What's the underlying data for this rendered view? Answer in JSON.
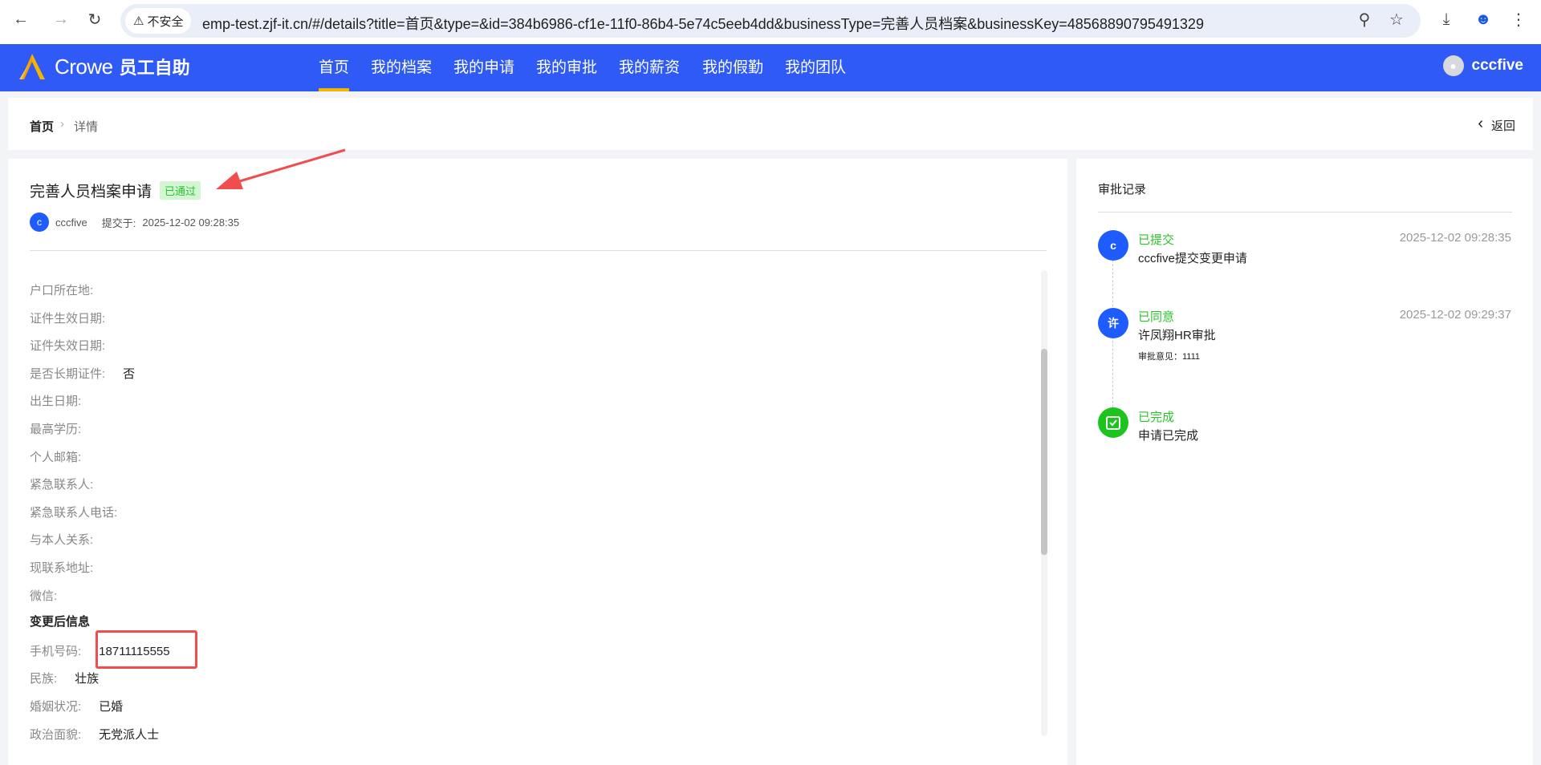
{
  "browser": {
    "insecure_label": "不安全",
    "url": "emp-test.zjf-it.cn/#/details?title=首页&type=&id=384b6986-cf1e-11f0-86b4-5e74c5eeb4dd&businessType=完善人员档案&businessKey=48568890795491329"
  },
  "header": {
    "brand": "Crowe",
    "app_name": "员工自助",
    "nav": [
      "首页",
      "我的档案",
      "我的申请",
      "我的审批",
      "我的薪资",
      "我的假勤",
      "我的团队"
    ],
    "active_index": 0,
    "user": "cccfive",
    "accent": "#2f5af5"
  },
  "breadcrumb": {
    "home": "首页",
    "current": "详情",
    "back": "返回"
  },
  "detail": {
    "title": "完善人员档案申请",
    "status": "已通过",
    "submitter_initial": "c",
    "submitter": "cccfive",
    "submitted_label": "提交于:",
    "submitted_at": "2025-12-02 09:28:35",
    "fields": [
      {
        "label": "户口所在地:",
        "value": ""
      },
      {
        "label": "证件生效日期:",
        "value": ""
      },
      {
        "label": "证件失效日期:",
        "value": ""
      },
      {
        "label": "是否长期证件:",
        "value": "否"
      },
      {
        "label": "出生日期:",
        "value": ""
      },
      {
        "label": "最高学历:",
        "value": ""
      },
      {
        "label": "个人邮箱:",
        "value": ""
      },
      {
        "label": "紧急联系人:",
        "value": ""
      },
      {
        "label": "紧急联系人电话:",
        "value": ""
      },
      {
        "label": "与本人关系:",
        "value": ""
      },
      {
        "label": "现联系地址:",
        "value": ""
      },
      {
        "label": "微信:",
        "value": ""
      }
    ],
    "changed_section": "变更后信息",
    "changed_fields": [
      {
        "label": "手机号码:",
        "value": "18711115555"
      },
      {
        "label": "民族:",
        "value": "壮族"
      },
      {
        "label": "婚姻状况:",
        "value": "已婚"
      },
      {
        "label": "政治面貌:",
        "value": "无党派人士"
      }
    ]
  },
  "approval": {
    "title": "审批记录",
    "steps": [
      {
        "initial": "c",
        "status": "已提交",
        "desc": "cccfive提交变更申请",
        "time": "2025-12-02 09:28:35"
      },
      {
        "initial": "许",
        "status": "已同意",
        "desc": "许凤翔HR审批",
        "comment": "审批意见：1111",
        "time": "2025-12-02 09:29:37"
      },
      {
        "status": "已完成",
        "desc": "申请已完成"
      }
    ]
  }
}
